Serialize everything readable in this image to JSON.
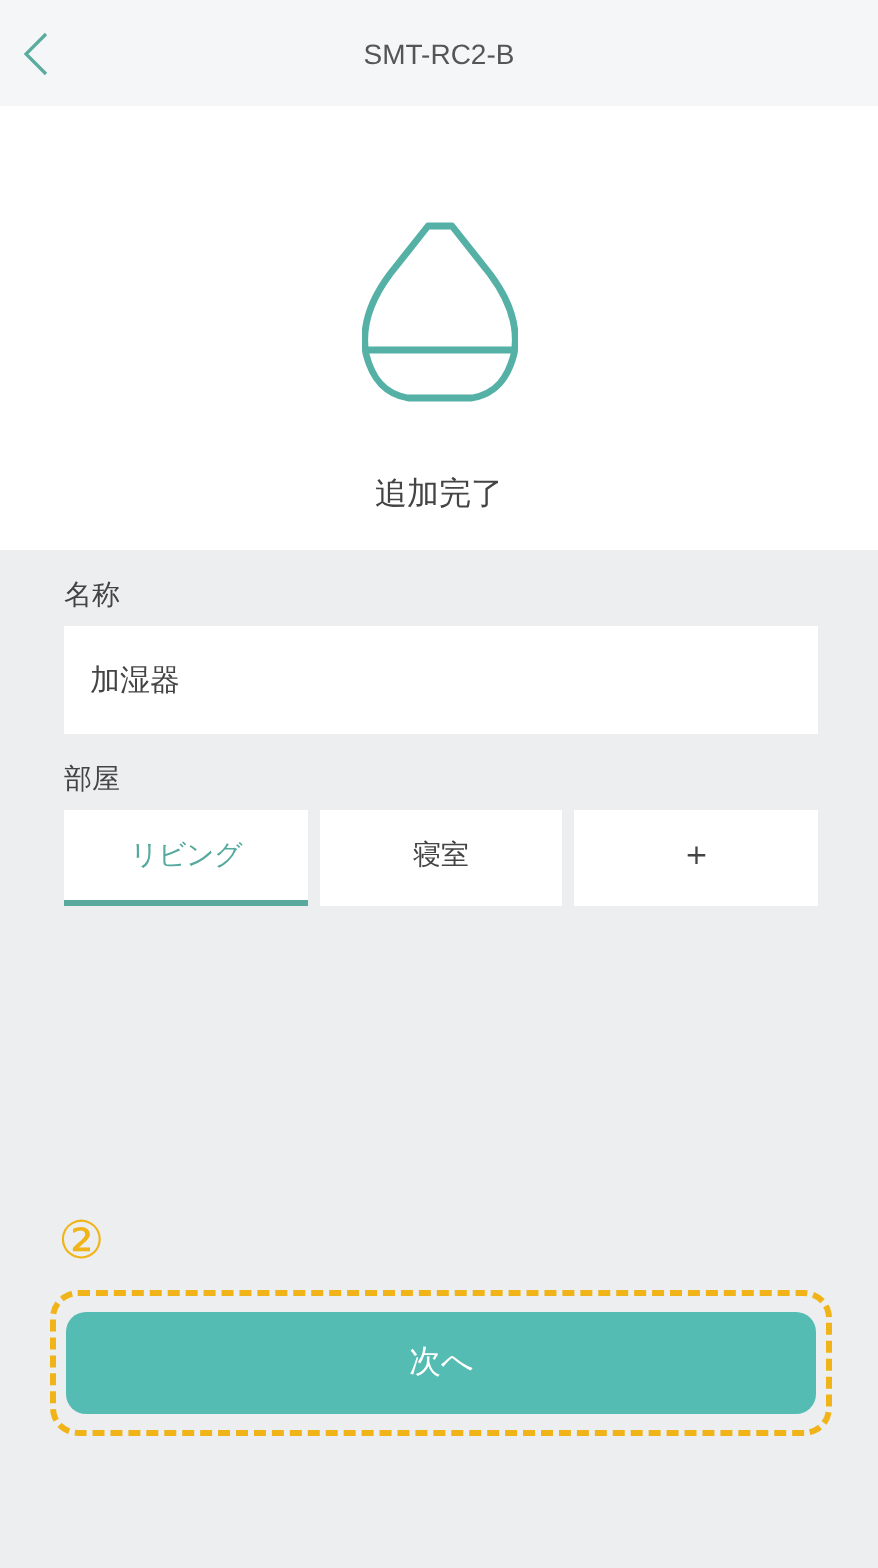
{
  "header": {
    "title": "SMT-RC2-B"
  },
  "status": {
    "message": "追加完了"
  },
  "name_field": {
    "label": "名称",
    "value": "加湿器"
  },
  "room": {
    "label": "部屋",
    "tabs": [
      {
        "label": "リビング",
        "selected": true
      },
      {
        "label": "寝室",
        "selected": false
      },
      {
        "label": "+",
        "selected": false
      }
    ]
  },
  "step_marker": "②",
  "next_button": {
    "label": "次へ",
    "highlighted": true
  }
}
